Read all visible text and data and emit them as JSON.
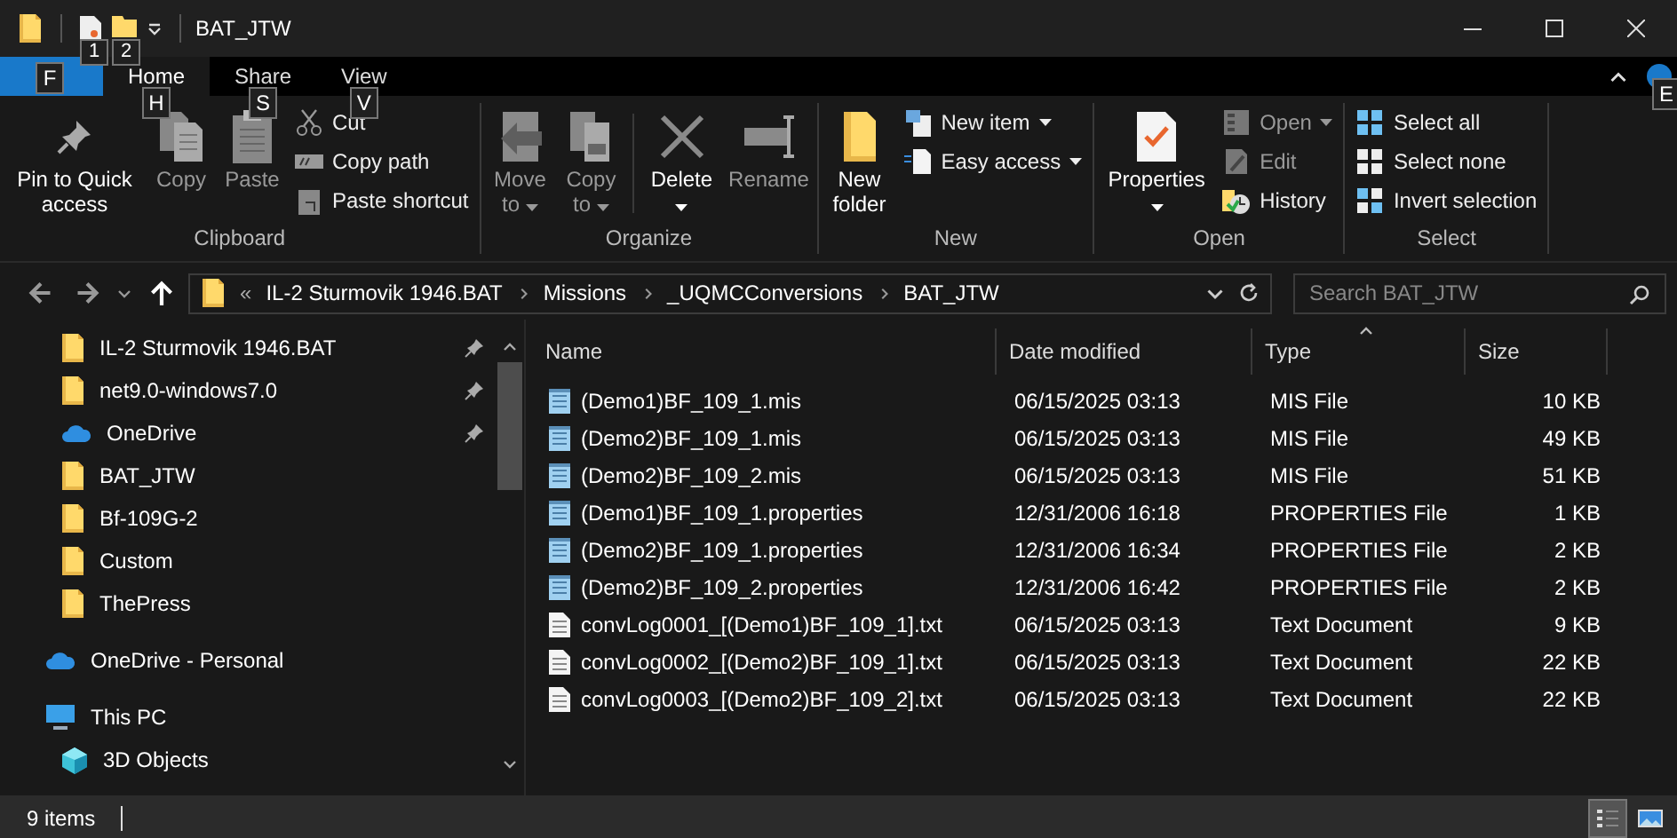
{
  "window": {
    "title": "BAT_JTW"
  },
  "quick_access_toolbar": [
    {
      "keytip": "1"
    },
    {
      "keytip": "2"
    }
  ],
  "file_tab": {
    "keytip": "F"
  },
  "tabs": [
    {
      "label": "Home",
      "keytip": "H",
      "selected": true
    },
    {
      "label": "Share",
      "keytip": "S",
      "selected": false
    },
    {
      "label": "View",
      "keytip": "V",
      "selected": false
    }
  ],
  "help": {
    "keytip": "E"
  },
  "ribbon": {
    "groups": [
      {
        "label": "Clipboard",
        "items": [
          {
            "kind": "large",
            "label": "Pin to Quick access",
            "disabled": false
          },
          {
            "kind": "large",
            "label": "Copy",
            "disabled": true
          },
          {
            "kind": "large",
            "label": "Paste",
            "disabled": true
          },
          {
            "kind": "column",
            "items": [
              {
                "label": "Cut",
                "disabled": false
              },
              {
                "label": "Copy path",
                "disabled": false
              },
              {
                "label": "Paste shortcut",
                "disabled": false
              }
            ]
          }
        ]
      },
      {
        "label": "Organize",
        "items": [
          {
            "kind": "large",
            "label": "Move to",
            "disabled": true,
            "dropdown": true
          },
          {
            "kind": "large",
            "label": "Copy to",
            "disabled": true,
            "dropdown": true
          },
          {
            "kind": "divider"
          },
          {
            "kind": "large",
            "label": "Delete",
            "disabled": false,
            "dropdown": true
          },
          {
            "kind": "large",
            "label": "Rename",
            "disabled": true
          }
        ]
      },
      {
        "label": "New",
        "items": [
          {
            "kind": "large",
            "label": "New folder",
            "disabled": false
          },
          {
            "kind": "column",
            "items": [
              {
                "label": "New item",
                "disabled": false,
                "dropdown": true
              },
              {
                "label": "Easy access",
                "disabled": false,
                "dropdown": true
              }
            ]
          }
        ]
      },
      {
        "label": "Open",
        "items": [
          {
            "kind": "large",
            "label": "Properties",
            "disabled": false,
            "dropdown": true
          },
          {
            "kind": "column",
            "items": [
              {
                "label": "Open",
                "disabled": true,
                "dropdown": true
              },
              {
                "label": "Edit",
                "disabled": true
              },
              {
                "label": "History",
                "disabled": false
              }
            ]
          }
        ]
      },
      {
        "label": "Select",
        "items": [
          {
            "kind": "column",
            "items": [
              {
                "label": "Select all",
                "disabled": false
              },
              {
                "label": "Select none",
                "disabled": false
              },
              {
                "label": "Invert selection",
                "disabled": false
              }
            ]
          }
        ]
      }
    ]
  },
  "address_bar": {
    "overflow": "«",
    "crumbs": [
      "IL-2 Sturmovik 1946.BAT",
      "Missions",
      "_UQMCConversions",
      "BAT_JTW"
    ]
  },
  "search": {
    "placeholder": "Search BAT_JTW"
  },
  "nav_pane": {
    "quick_access": [
      {
        "label": "IL-2 Sturmovik 1946.BAT",
        "kind": "folder",
        "pinned": true
      },
      {
        "label": "net9.0-windows7.0",
        "kind": "folder",
        "pinned": true
      },
      {
        "label": "OneDrive",
        "kind": "cloud",
        "pinned": true
      },
      {
        "label": "BAT_JTW",
        "kind": "folder",
        "pinned": false
      },
      {
        "label": "Bf-109G-2",
        "kind": "folder",
        "pinned": false
      },
      {
        "label": "Custom",
        "kind": "folder",
        "pinned": false
      },
      {
        "label": "ThePress",
        "kind": "folder",
        "pinned": false
      }
    ],
    "tree": [
      {
        "label": "OneDrive - Personal",
        "kind": "cloud"
      },
      {
        "label": "This PC",
        "kind": "pc",
        "children": [
          {
            "label": "3D Objects",
            "kind": "cube"
          }
        ]
      }
    ]
  },
  "file_list": {
    "columns": [
      {
        "label": "Name",
        "sorted": false
      },
      {
        "label": "Date modified",
        "sorted": false
      },
      {
        "label": "Type",
        "sorted": true
      },
      {
        "label": "Size",
        "sorted": false
      }
    ],
    "rows": [
      {
        "kind": "mis",
        "name": "(Demo1)BF_109_1.mis",
        "date": "06/15/2025 03:13",
        "type": "MIS File",
        "size": "10 KB"
      },
      {
        "kind": "mis",
        "name": "(Demo2)BF_109_1.mis",
        "date": "06/15/2025 03:13",
        "type": "MIS File",
        "size": "49 KB"
      },
      {
        "kind": "mis",
        "name": "(Demo2)BF_109_2.mis",
        "date": "06/15/2025 03:13",
        "type": "MIS File",
        "size": "51 KB"
      },
      {
        "kind": "properties",
        "name": "(Demo1)BF_109_1.properties",
        "date": "12/31/2006 16:18",
        "type": "PROPERTIES File",
        "size": "1 KB"
      },
      {
        "kind": "properties",
        "name": "(Demo2)BF_109_1.properties",
        "date": "12/31/2006 16:34",
        "type": "PROPERTIES File",
        "size": "2 KB"
      },
      {
        "kind": "properties",
        "name": "(Demo2)BF_109_2.properties",
        "date": "12/31/2006 16:42",
        "type": "PROPERTIES File",
        "size": "2 KB"
      },
      {
        "kind": "txt",
        "name": "convLog0001_[(Demo1)BF_109_1].txt",
        "date": "06/15/2025 03:13",
        "type": "Text Document",
        "size": "9 KB"
      },
      {
        "kind": "txt",
        "name": "convLog0002_[(Demo2)BF_109_1].txt",
        "date": "06/15/2025 03:13",
        "type": "Text Document",
        "size": "22 KB"
      },
      {
        "kind": "txt",
        "name": "convLog0003_[(Demo2)BF_109_2].txt",
        "date": "06/15/2025 03:13",
        "type": "Text Document",
        "size": "22 KB"
      }
    ]
  },
  "status_bar": {
    "item_count": "9 items",
    "views": [
      {
        "kind": "details",
        "selected": true
      },
      {
        "kind": "large_icons",
        "selected": false
      }
    ]
  }
}
